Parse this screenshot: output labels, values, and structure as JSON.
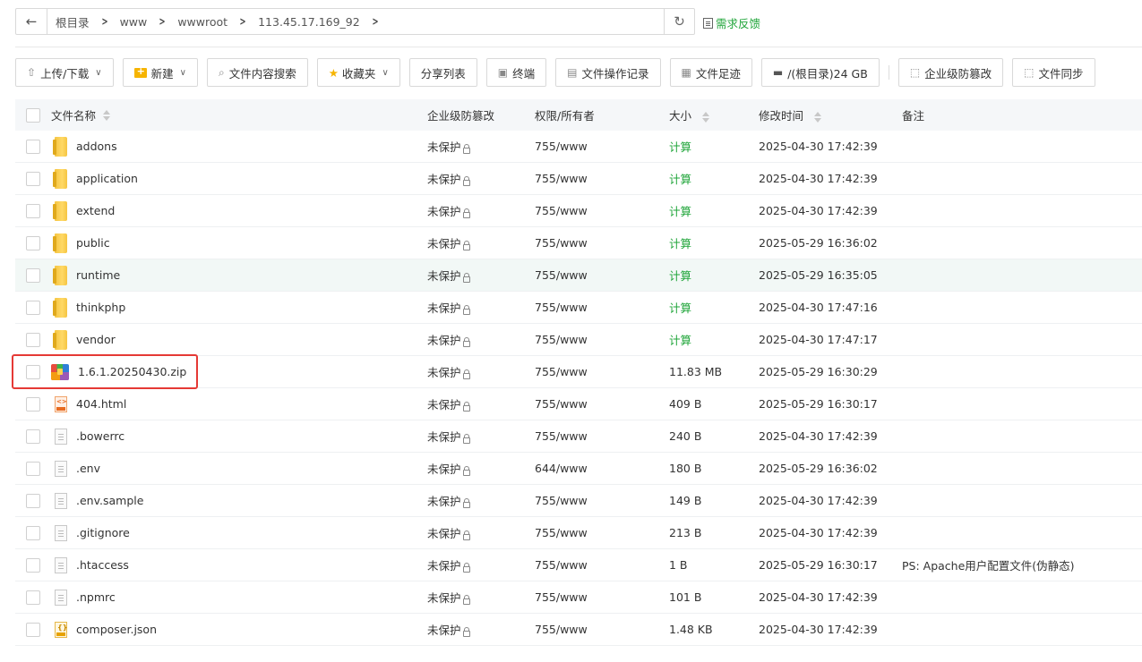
{
  "breadcrumb": [
    "根目录",
    "www",
    "wwwroot",
    "113.45.17.169_92"
  ],
  "feedback": "需求反馈",
  "toolbar": {
    "upload": "上传/下载",
    "new": "新建",
    "search": "文件内容搜索",
    "favorites": "收藏夹",
    "share": "分享列表",
    "terminal": "终端",
    "oplog": "文件操作记录",
    "footprint": "文件足迹",
    "disk": "/(根目录)24 GB",
    "tamper": "企业级防篡改",
    "sync": "文件同步"
  },
  "columns": {
    "name": "文件名称",
    "protect": "企业级防篡改",
    "perm": "权限/所有者",
    "size": "大小",
    "mtime": "修改时间",
    "note": "备注"
  },
  "rows": [
    {
      "icon": "folder-icon",
      "name": "addons",
      "protect": "未保护",
      "perm": "755/www",
      "size": "计算",
      "mtime": "2025-04-30 17:42:39",
      "note": ""
    },
    {
      "icon": "folder-icon",
      "name": "application",
      "protect": "未保护",
      "perm": "755/www",
      "size": "计算",
      "mtime": "2025-04-30 17:42:39",
      "note": ""
    },
    {
      "icon": "folder-icon",
      "name": "extend",
      "protect": "未保护",
      "perm": "755/www",
      "size": "计算",
      "mtime": "2025-04-30 17:42:39",
      "note": ""
    },
    {
      "icon": "folder-icon",
      "name": "public",
      "protect": "未保护",
      "perm": "755/www",
      "size": "计算",
      "mtime": "2025-05-29 16:36:02",
      "note": ""
    },
    {
      "icon": "folder-icon",
      "name": "runtime",
      "protect": "未保护",
      "perm": "755/www",
      "size": "计算",
      "mtime": "2025-05-29 16:35:05",
      "note": ""
    },
    {
      "icon": "folder-icon",
      "name": "thinkphp",
      "protect": "未保护",
      "perm": "755/www",
      "size": "计算",
      "mtime": "2025-04-30 17:47:16",
      "note": ""
    },
    {
      "icon": "folder-icon",
      "name": "vendor",
      "protect": "未保护",
      "perm": "755/www",
      "size": "计算",
      "mtime": "2025-04-30 17:47:17",
      "note": ""
    },
    {
      "icon": "zip-icon",
      "name": "1.6.1.20250430.zip",
      "protect": "未保护",
      "perm": "755/www",
      "size": "11.83 MB",
      "mtime": "2025-05-29 16:30:29",
      "note": ""
    },
    {
      "icon": "html-icon",
      "name": "404.html",
      "protect": "未保护",
      "perm": "755/www",
      "size": "409 B",
      "mtime": "2025-05-29 16:30:17",
      "note": ""
    },
    {
      "icon": "file-icon",
      "name": ".bowerrc",
      "protect": "未保护",
      "perm": "755/www",
      "size": "240 B",
      "mtime": "2025-04-30 17:42:39",
      "note": ""
    },
    {
      "icon": "file-icon",
      "name": ".env",
      "protect": "未保护",
      "perm": "644/www",
      "size": "180 B",
      "mtime": "2025-05-29 16:36:02",
      "note": ""
    },
    {
      "icon": "file-icon",
      "name": ".env.sample",
      "protect": "未保护",
      "perm": "755/www",
      "size": "149 B",
      "mtime": "2025-04-30 17:42:39",
      "note": ""
    },
    {
      "icon": "file-icon",
      "name": ".gitignore",
      "protect": "未保护",
      "perm": "755/www",
      "size": "213 B",
      "mtime": "2025-04-30 17:42:39",
      "note": ""
    },
    {
      "icon": "file-icon",
      "name": ".htaccess",
      "protect": "未保护",
      "perm": "755/www",
      "size": "1 B",
      "mtime": "2025-05-29 16:30:17",
      "note": "PS: Apache用户配置文件(伪静态)"
    },
    {
      "icon": "file-icon",
      "name": ".npmrc",
      "protect": "未保护",
      "perm": "755/www",
      "size": "101 B",
      "mtime": "2025-04-30 17:42:39",
      "note": ""
    },
    {
      "icon": "json-icon",
      "name": "composer.json",
      "protect": "未保护",
      "perm": "755/www",
      "size": "1.48 KB",
      "mtime": "2025-04-30 17:42:39",
      "note": ""
    }
  ],
  "highlighted_row": "runtime",
  "accent_color": "#20a53a",
  "annotation_color": "#e53935"
}
